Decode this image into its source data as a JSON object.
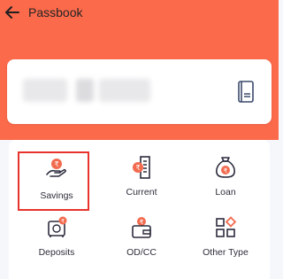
{
  "header": {
    "title": "Passbook",
    "back_icon": "arrow-left-icon"
  },
  "account_card": {
    "action_icon": "passbook-icon"
  },
  "account_types": [
    {
      "label": "Savings",
      "icon": "savings-hand-coin-icon"
    },
    {
      "label": "Current",
      "icon": "current-building-coin-icon"
    },
    {
      "label": "Loan",
      "icon": "loan-money-bag-icon"
    },
    {
      "label": "Deposits",
      "icon": "deposits-safe-icon"
    },
    {
      "label": "OD/CC",
      "icon": "odcc-wallet-icon"
    },
    {
      "label": "Other Type",
      "icon": "other-type-grid-icon"
    }
  ],
  "colors": {
    "brand": "#fb6a4b",
    "icon_dark": "#2b2b3d",
    "icon_accent": "#f26b4f",
    "highlight": "#e8332c"
  }
}
